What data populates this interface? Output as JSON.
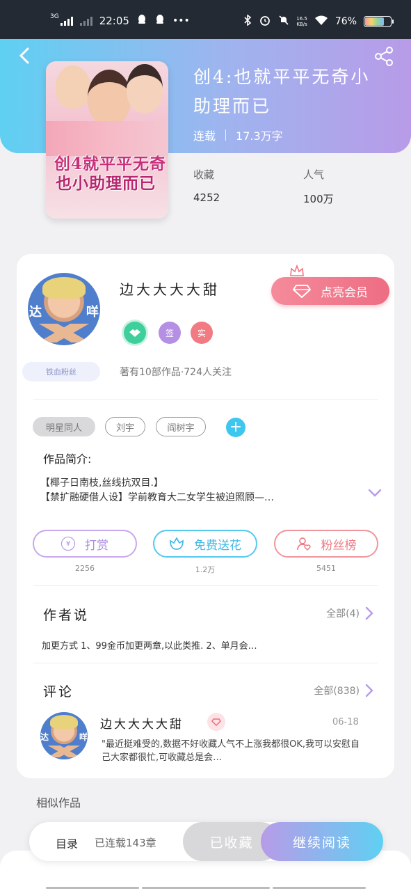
{
  "status_bar": {
    "network": "3G",
    "time": "22:05",
    "more": "•••",
    "speed_value": "16.5",
    "speed_unit": "KB/s",
    "battery": "76%"
  },
  "book": {
    "title": "创4:也就平平无奇小助理而已",
    "cover_line1": "创4就平平无奇",
    "cover_line2": "也小助理而已",
    "status": "连载",
    "words": "17.3万字",
    "favorites_label": "收藏",
    "favorites_value": "4252",
    "popularity_label": "人气",
    "popularity_value": "100万"
  },
  "author": {
    "name": "边大大大大甜",
    "avatar_left": "达",
    "avatar_right": "咩",
    "vip_button": "点亮会员",
    "badge_sign": "签",
    "badge_real": "实",
    "fan_tag": "铁血粉丝",
    "works_info": "著有10部作品·724人关注"
  },
  "tags": [
    "明星同人",
    "刘宇",
    "阎树宇"
  ],
  "intro": {
    "label": "作品简介:",
    "line1": "【椰子日南枝,丝线抗双目.】",
    "line2": "【禁扩融硬借人设】学前教育大二女学生被迫照顾—…"
  },
  "actions": [
    {
      "label": "打赏",
      "count": "2256",
      "icon": "¥"
    },
    {
      "label": "免费送花",
      "count": "1.2万",
      "icon": "flower"
    },
    {
      "label": "粉丝榜",
      "count": "5451",
      "icon": "person"
    }
  ],
  "author_says": {
    "title": "作者说",
    "more": "全部(4)",
    "text": "加更方式 1、99金币加更两章,以此类推. 2、单月会…"
  },
  "comments": {
    "title": "评论",
    "more": "全部(838)",
    "items": [
      {
        "name": "边大大大大甜",
        "date": "06-18",
        "text": "\"最近挺难受的,数据不好收藏人气不上涨我都很OK,我可以安慰自己大家都很忙,可收藏总是会…"
      }
    ]
  },
  "similar": {
    "title": "相似作品"
  },
  "bottom": {
    "toc": "目录",
    "toc_sub": "已连载143章",
    "collected": "已收藏",
    "continue": "继续阅读"
  }
}
